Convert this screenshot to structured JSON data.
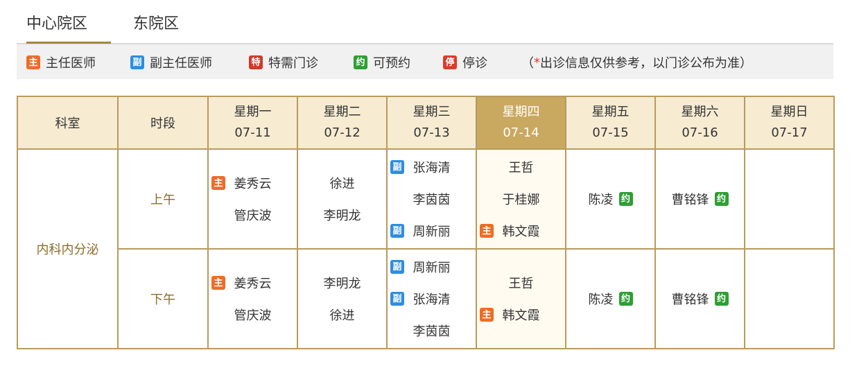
{
  "tabs": [
    {
      "label": "中心院区",
      "active": true
    },
    {
      "label": "东院区",
      "active": false
    }
  ],
  "legend": {
    "items": [
      {
        "badge": "主",
        "label": "主任医师",
        "color": "#ee6c27"
      },
      {
        "badge": "副",
        "label": "副主任医师",
        "color": "#2f8ddd"
      },
      {
        "badge": "特",
        "label": "特需门诊",
        "color": "#d4362a"
      },
      {
        "badge": "约",
        "label": "可预约",
        "color": "#2e9e35"
      },
      {
        "badge": "停",
        "label": "停诊",
        "color": "#dd3a2a"
      }
    ],
    "note_open": "（",
    "note_star": "*",
    "note_text": "出诊信息仅供参考，以门诊公布为准",
    "note_close": "）"
  },
  "table": {
    "dept_header": "科室",
    "period_header": "时段",
    "days": [
      {
        "weekday": "星期一",
        "date": "07-11",
        "today": false
      },
      {
        "weekday": "星期二",
        "date": "07-12",
        "today": false
      },
      {
        "weekday": "星期三",
        "date": "07-13",
        "today": false
      },
      {
        "weekday": "星期四",
        "date": "07-14",
        "today": true
      },
      {
        "weekday": "星期五",
        "date": "07-15",
        "today": false
      },
      {
        "weekday": "星期六",
        "date": "07-16",
        "today": false
      },
      {
        "weekday": "星期日",
        "date": "07-17",
        "today": false
      }
    ],
    "dept": "内科内分泌",
    "rows": [
      {
        "period": "上午",
        "cells": [
          [
            {
              "name": "姜秀云",
              "badge": "主"
            },
            {
              "name": "管庆波",
              "badge": ""
            }
          ],
          [
            {
              "name": "徐进",
              "badge": ""
            },
            {
              "name": "李明龙",
              "badge": ""
            }
          ],
          [
            {
              "name": "张海清",
              "badge": "副"
            },
            {
              "name": "李茵茵",
              "badge": ""
            },
            {
              "name": "周新丽",
              "badge": "副"
            }
          ],
          [
            {
              "name": "王哲",
              "badge": ""
            },
            {
              "name": "于桂娜",
              "badge": ""
            },
            {
              "name": "韩文霞",
              "badge": "主"
            }
          ],
          [
            {
              "name": "陈凌",
              "badge": "",
              "booking": "约"
            }
          ],
          [
            {
              "name": "曹铭锋",
              "badge": "",
              "booking": "约"
            }
          ],
          []
        ]
      },
      {
        "period": "下午",
        "cells": [
          [
            {
              "name": "姜秀云",
              "badge": "主"
            },
            {
              "name": "管庆波",
              "badge": ""
            }
          ],
          [
            {
              "name": "李明龙",
              "badge": ""
            },
            {
              "name": "徐进",
              "badge": ""
            }
          ],
          [
            {
              "name": "周新丽",
              "badge": "副"
            },
            {
              "name": "张海清",
              "badge": "副"
            },
            {
              "name": "李茵茵",
              "badge": ""
            }
          ],
          [
            {
              "name": "王哲",
              "badge": ""
            },
            {
              "name": "韩文霞",
              "badge": "主"
            }
          ],
          [
            {
              "name": "陈凌",
              "badge": "",
              "booking": "约"
            }
          ],
          [
            {
              "name": "曹铭锋",
              "badge": "",
              "booking": "约"
            }
          ],
          []
        ]
      }
    ]
  }
}
